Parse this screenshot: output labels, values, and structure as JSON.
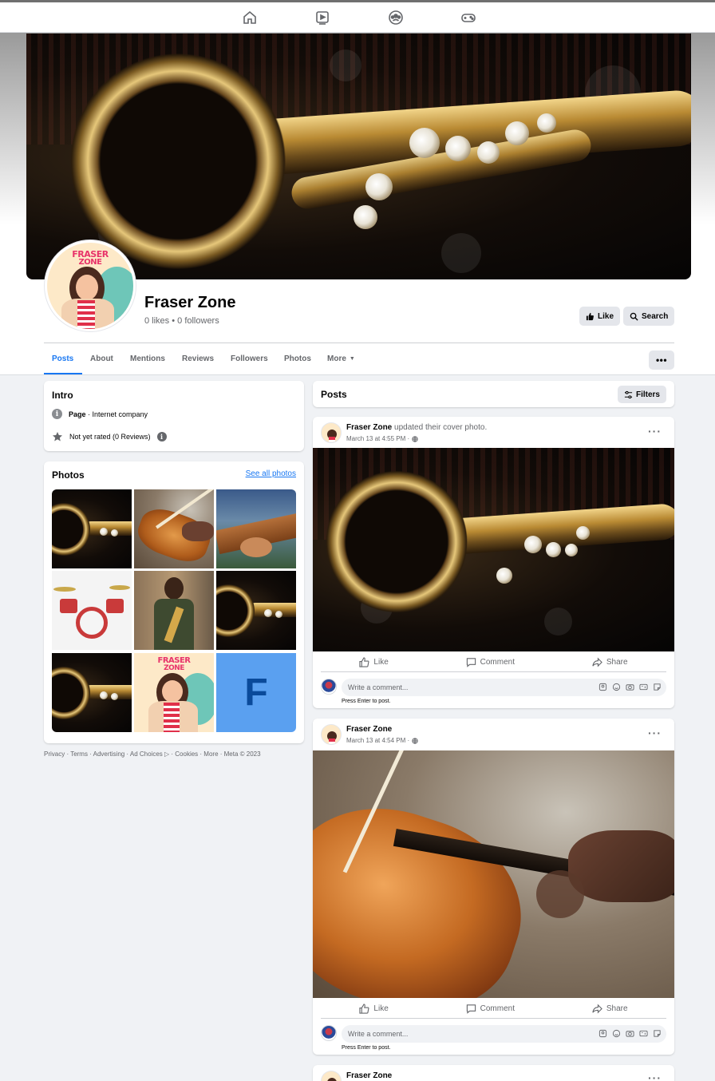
{
  "nav": {
    "icons": [
      "home-icon",
      "watch-icon",
      "groups-icon",
      "gaming-icon"
    ]
  },
  "page": {
    "name": "Fraser Zone",
    "stats": "0 likes • 0 followers",
    "logo_text_1": "FRASER",
    "logo_text_2": "ZONE",
    "like_button": "Like",
    "search_button": "Search"
  },
  "tabs": [
    {
      "label": "Posts",
      "active": true
    },
    {
      "label": "About"
    },
    {
      "label": "Mentions"
    },
    {
      "label": "Reviews"
    },
    {
      "label": "Followers"
    },
    {
      "label": "Photos"
    },
    {
      "label": "More"
    }
  ],
  "intro": {
    "title": "Intro",
    "category_bold": "Page",
    "category_rest": " · Internet company",
    "rating": "Not yet rated (0 Reviews)"
  },
  "photos": {
    "title": "Photos",
    "see_all": "See all photos",
    "items": [
      "saxophone",
      "violin",
      "guitar",
      "drum kit",
      "saxophone player",
      "saxophone",
      "saxophone",
      "Fraser Zone logo",
      "F"
    ]
  },
  "footer": "Privacy · Terms · Advertising · Ad Choices ▷ · Cookies · More · Meta © 2023",
  "posts_header": {
    "title": "Posts",
    "filters": "Filters"
  },
  "posts": [
    {
      "author": "Fraser Zone",
      "action": " updated their cover photo.",
      "time": "March 13 at 4:55 PM ·",
      "like": "Like",
      "comment": "Comment",
      "share": "Share",
      "comment_placeholder": "Write a comment...",
      "press_enter": "Press Enter to post."
    },
    {
      "author": "Fraser Zone",
      "action": "",
      "time": "March 13 at 4:54 PM ·",
      "like": "Like",
      "comment": "Comment",
      "share": "Share",
      "comment_placeholder": "Write a comment...",
      "press_enter": "Press Enter to post."
    },
    {
      "author": "Fraser Zone"
    }
  ],
  "colors": {
    "accent": "#1877f2",
    "background": "#f0f2f5",
    "secondary_text": "#65676b"
  }
}
